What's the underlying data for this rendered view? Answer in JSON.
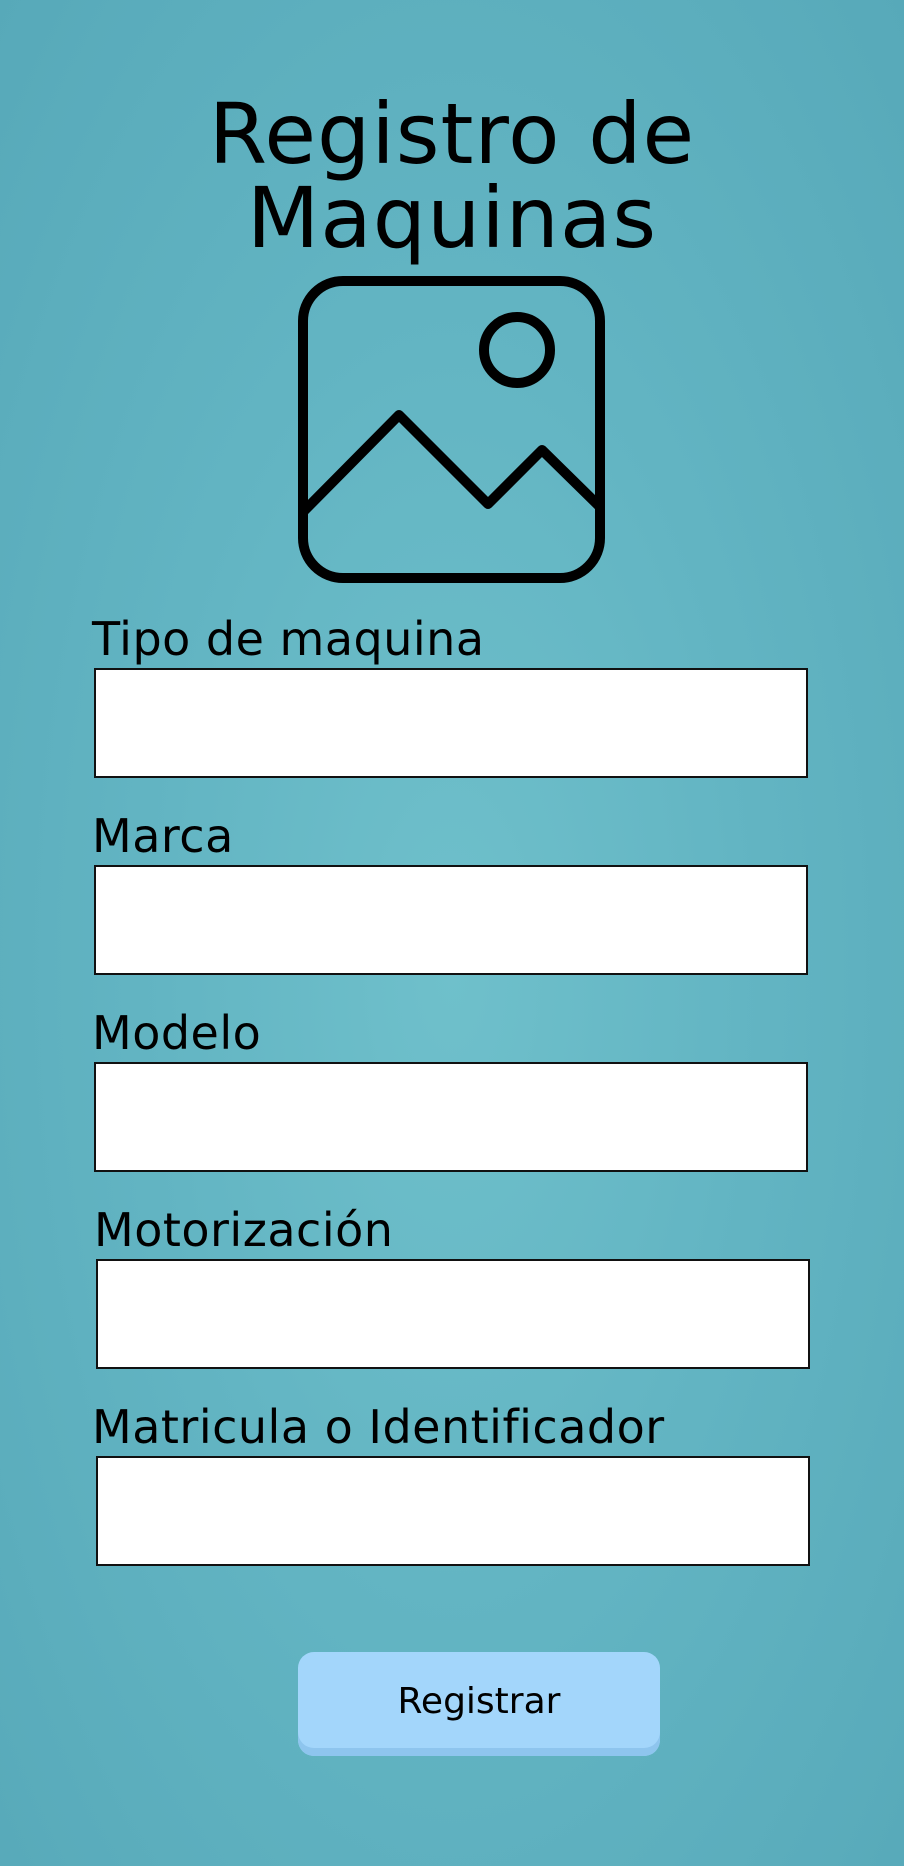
{
  "header": {
    "title_line1": "Registro de",
    "title_line2": "Maquinas",
    "icon": "image-placeholder-icon"
  },
  "form": {
    "fields": [
      {
        "label": "Tipo de maquina",
        "value": "",
        "placeholder": ""
      },
      {
        "label": "Marca",
        "value": "",
        "placeholder": ""
      },
      {
        "label": "Modelo",
        "value": "",
        "placeholder": ""
      },
      {
        "label": "Motorización",
        "value": "",
        "placeholder": ""
      },
      {
        "label": "Matricula o Identificador",
        "value": "",
        "placeholder": ""
      }
    ],
    "submit_label": "Registrar"
  },
  "colors": {
    "background": "#63b5c3",
    "button": "#a3d6fb",
    "input_background": "#ffffff",
    "text": "#000000"
  }
}
